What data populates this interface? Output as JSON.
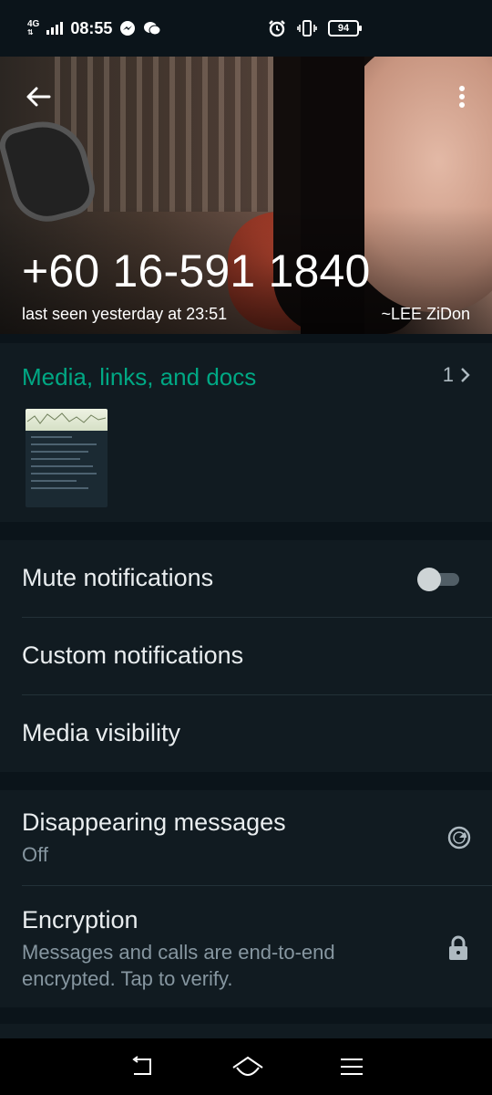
{
  "status_bar": {
    "network": "4G",
    "time": "08:55",
    "battery": "94"
  },
  "header": {
    "contact_name": "+60 16-591 1840",
    "last_seen": "last seen yesterday at 23:51",
    "push_name": "~LEE ZiDon",
    "icons": [
      "back-arrow-icon",
      "more-vert-icon"
    ]
  },
  "media": {
    "title": "Media, links, and docs",
    "count": "1"
  },
  "settings": {
    "mute_label": "Mute notifications",
    "mute_enabled": false,
    "custom_label": "Custom notifications",
    "visibility_label": "Media visibility"
  },
  "privacy": {
    "disappearing_label": "Disappearing messages",
    "disappearing_value": "Off",
    "encryption_label": "Encryption",
    "encryption_desc_line1": "Messages and calls are end-to-end",
    "encryption_desc_line2": "encrypted. Tap to verify."
  },
  "colors": {
    "accent": "#00a884",
    "background": "#0b141a",
    "surface": "#111b21"
  }
}
